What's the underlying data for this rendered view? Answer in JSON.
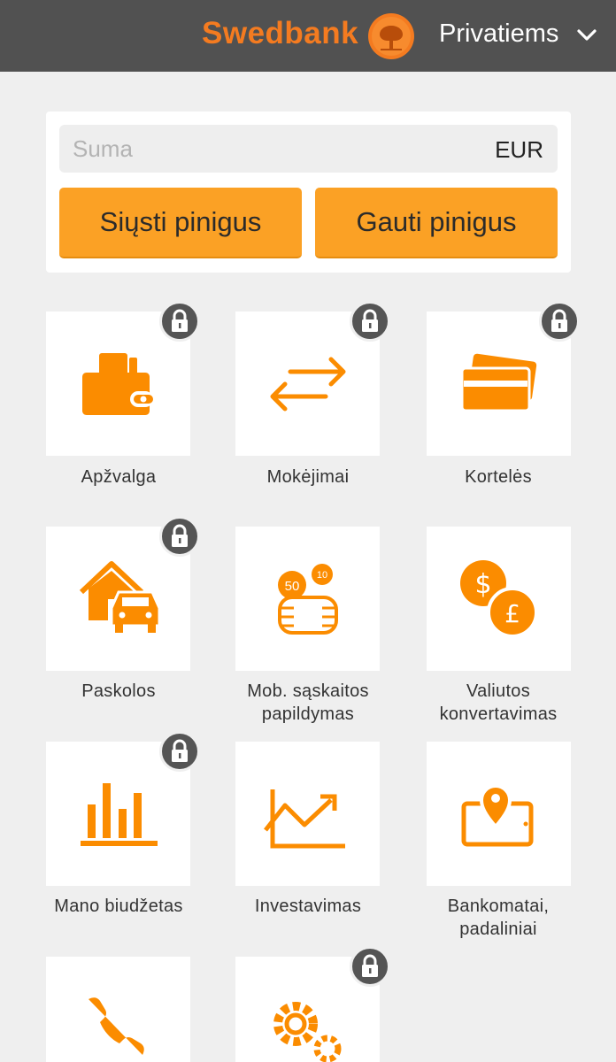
{
  "header": {
    "brand": "Swedbank",
    "segment": "Privatiems",
    "brand_color": "#f47b20",
    "background_color": "#515151",
    "logo_icon": "oak-tree-logo",
    "segment_icon": "chevron-down-icon"
  },
  "transfer": {
    "amount_placeholder": "Suma",
    "amount_value": "",
    "currency": "EUR",
    "send_label": "Siųsti pinigus",
    "receive_label": "Gauti pinigus",
    "button_color": "#fba125"
  },
  "tiles": [
    {
      "label": "Apžvalga",
      "icon": "wallet-icon",
      "locked": true
    },
    {
      "label": "Mokėjimai",
      "icon": "transfer-arrows-icon",
      "locked": true
    },
    {
      "label": "Kortelės",
      "icon": "cards-icon",
      "locked": true
    },
    {
      "label_line1": "Paskolos",
      "icon": "house-car-icon",
      "locked": true
    },
    {
      "label_line1": "Mob. sąskaitos",
      "label_line2": "papildymas",
      "icon": "phone-topup-icon",
      "locked": false
    },
    {
      "label_line1": "Valiutos",
      "label_line2": "konvertavimas",
      "icon": "currency-exchange-icon",
      "locked": false
    },
    {
      "label": "Mano biudžetas",
      "icon": "bar-chart-icon",
      "locked": true
    },
    {
      "label": "Investavimas",
      "icon": "trend-chart-icon",
      "locked": false
    },
    {
      "label_line1": "Bankomatai,",
      "label_line2": "padaliniai",
      "icon": "map-pin-icon",
      "locked": false
    },
    {
      "icon": "phone-icon",
      "locked": false
    },
    {
      "icon": "settings-gears-icon",
      "locked": true
    }
  ],
  "icon_color": "#fb8c00",
  "lock_icon": "padlock-icon"
}
